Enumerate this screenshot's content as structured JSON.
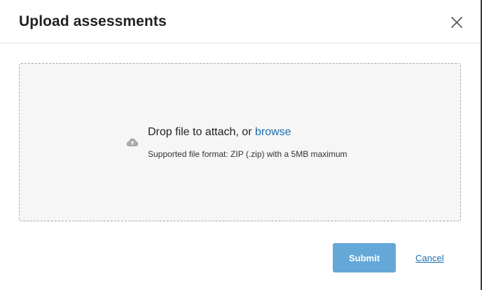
{
  "dialog": {
    "title": "Upload assessments",
    "close_icon": "close-icon"
  },
  "dropzone": {
    "icon": "cloud-upload-icon",
    "prompt": "Drop file to attach, or ",
    "browse_label": "browse",
    "format_note": "Supported file format: ZIP (.zip) with a 5MB maximum"
  },
  "footer": {
    "submit_label": "Submit",
    "cancel_label": "Cancel"
  },
  "colors": {
    "accent": "#1a6fb0",
    "submit_bg": "#64a8d8",
    "dropzone_bg": "#f6f6f6"
  }
}
